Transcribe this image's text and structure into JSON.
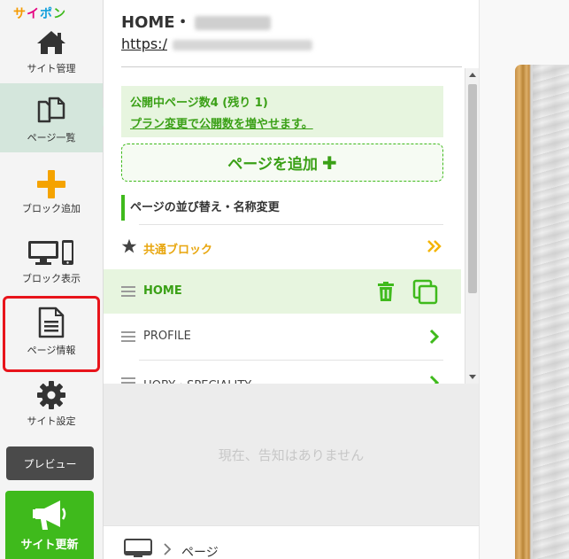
{
  "app": {
    "logo_chars": [
      "サ",
      "イ",
      "ポ",
      "ン"
    ],
    "logo_colors": [
      "#f59a00",
      "#e5007f",
      "#14a0dc",
      "#3fba1c"
    ]
  },
  "sidebar": {
    "items": [
      {
        "label": "サイト管理",
        "icon": "home-icon"
      },
      {
        "label": "ページ一覧",
        "icon": "pages-icon",
        "active": true
      },
      {
        "label": "ブロック追加",
        "icon": "plus-icon"
      },
      {
        "label": "ブロック表示",
        "icon": "devices-icon"
      },
      {
        "label": "ページ情報",
        "icon": "document-icon",
        "highlighted": true
      },
      {
        "label": "サイト設定",
        "icon": "gear-icon"
      }
    ],
    "preview_label": "プレビュー",
    "update_label": "サイト更新"
  },
  "page": {
    "name": "HOME・",
    "url": "https:/"
  },
  "info": {
    "published_count": "公開中ページ数4 (残り 1)",
    "plan_link": "プラン変更で公開数を増やせます。"
  },
  "add_page_label": "ページを追加",
  "sort_heading": "ページの並び替え・名称変更",
  "common_block_label": "共通ブロック",
  "pages": [
    {
      "label": "HOME",
      "selected": true
    },
    {
      "label": "PROFILE",
      "selected": false
    },
    {
      "label": "HOBY・SPECIALITY",
      "selected": false
    }
  ],
  "notice_text": "現在、告知はありません",
  "breadcrumb_label": "ページ",
  "colors": {
    "accent_green": "#3fba1c",
    "highlight_red": "#e8141b",
    "common_block_orange": "#e8a60e",
    "add_block_orange": "#f5a300"
  }
}
